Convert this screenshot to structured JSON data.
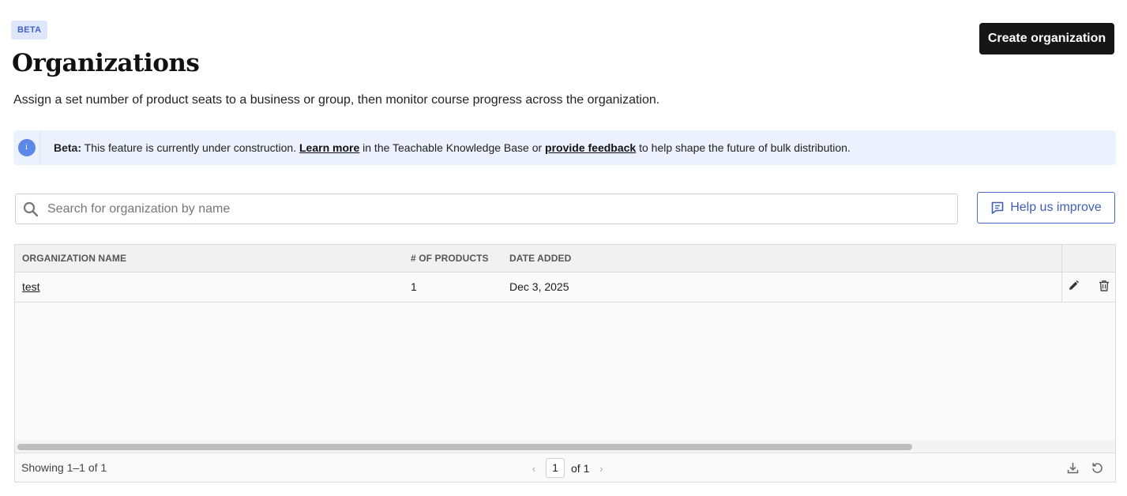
{
  "header": {
    "badge": "BETA",
    "title": "Organizations",
    "create_button": "Create organization",
    "subtitle": "Assign a set number of product seats to a business or group, then monitor course progress across the organization."
  },
  "banner": {
    "icon": "info-icon",
    "lead": "Beta:",
    "text1": " This feature is currently under construction. ",
    "link1": "Learn more",
    "text2": " in the Teachable Knowledge Base or ",
    "link2": "provide feedback",
    "text3": " to help shape the future of bulk distribution."
  },
  "search": {
    "placeholder": "Search for organization by name",
    "icon": "search-icon"
  },
  "help_button": {
    "label": "Help us improve",
    "icon": "feedback-icon"
  },
  "table": {
    "columns": [
      "ORGANIZATION NAME",
      "# OF PRODUCTS",
      "DATE ADDED"
    ],
    "rows": [
      {
        "name": "test",
        "products": "1",
        "date_added": "Dec 3, 2025"
      }
    ],
    "row_actions": [
      "edit-icon",
      "trash-icon"
    ],
    "horizontal_scroll_position": 0.81
  },
  "footer": {
    "showing": "Showing 1–1 of 1",
    "page": "1",
    "of_pages": "of 1",
    "icons": [
      "download-icon",
      "refresh-icon"
    ]
  },
  "colors": {
    "primary_button": "#161616",
    "accent_blue": "#3f5fb5",
    "banner_bg": "#ebf1fd",
    "badge_bg": "#dde6fa"
  }
}
